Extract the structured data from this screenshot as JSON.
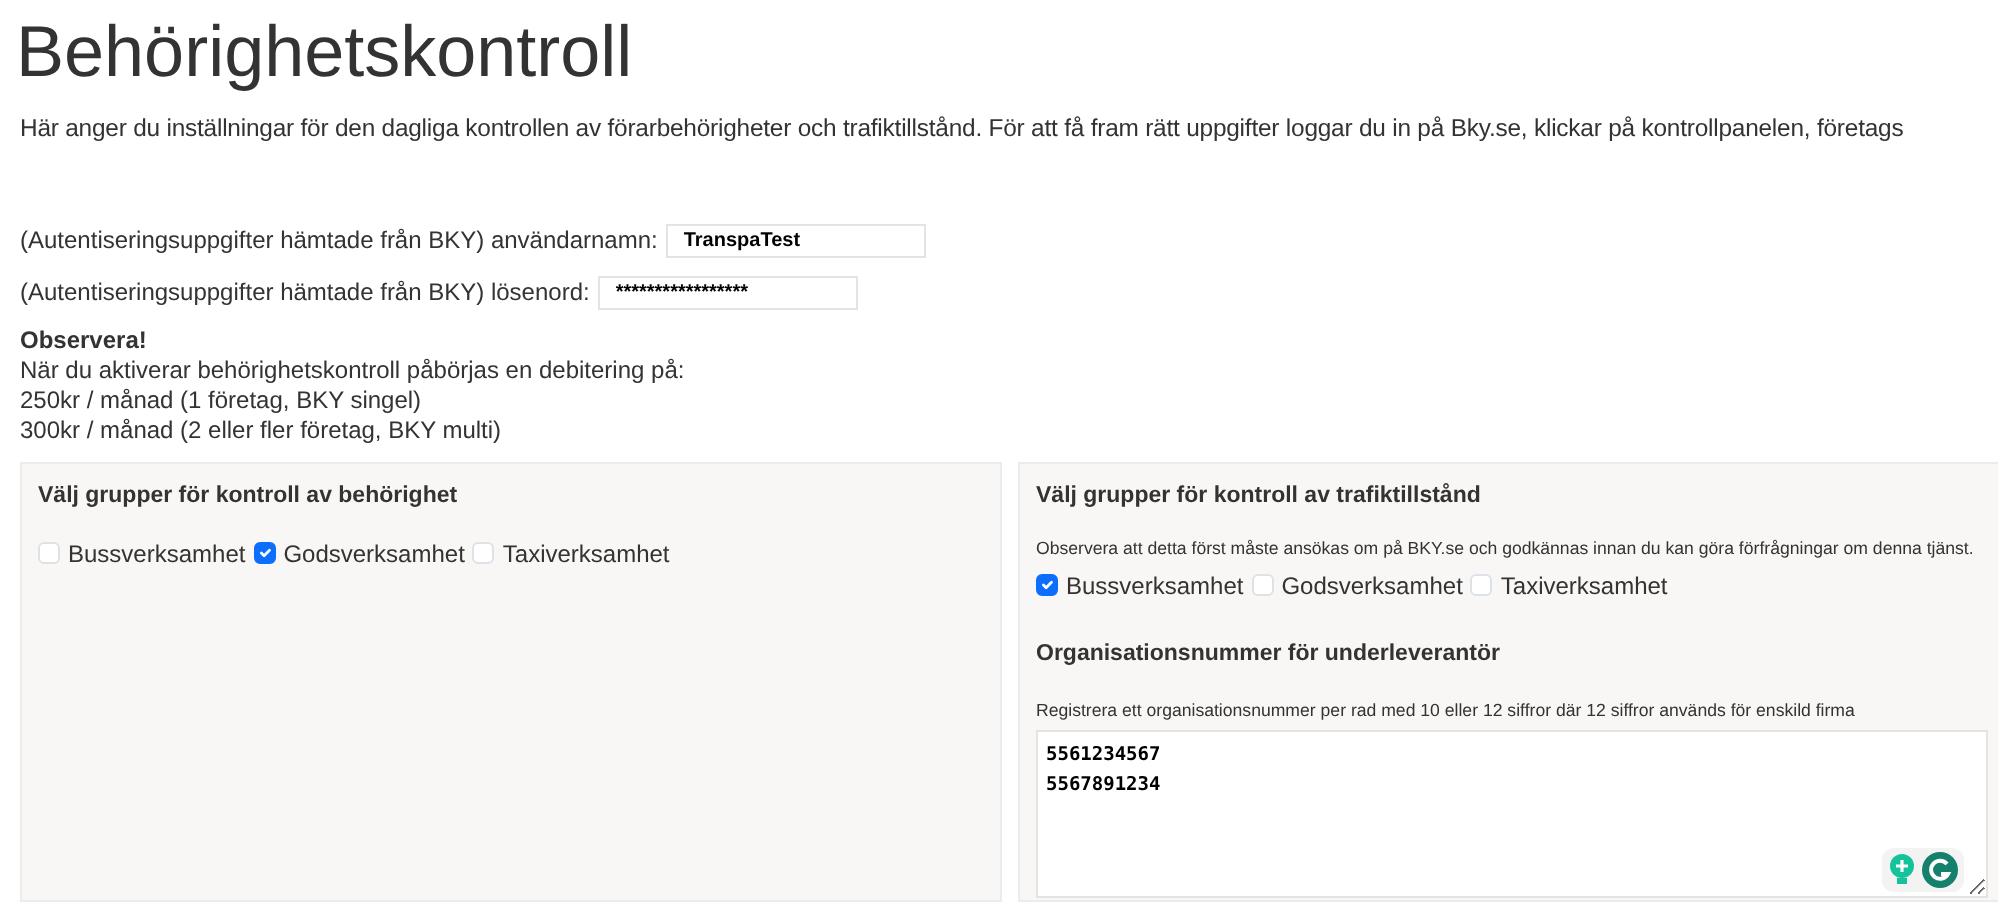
{
  "title": "Behörighetskontroll",
  "intro": "Här anger du inställningar för den dagliga kontrollen av förarbehörigheter och trafiktillstånd. För att få fram rätt uppgifter loggar du in på Bky.se, klickar på kontrollpanelen, företags",
  "credentials": [
    {
      "label": "(Autentiseringsuppgifter hämtade från BKY) användarnamn:",
      "value": "TranspaTest"
    },
    {
      "label": "(Autentiseringsuppgifter hämtade från BKY) lösenord:",
      "value": "*****************"
    }
  ],
  "notice": {
    "heading": "Observera!",
    "lines": [
      "När du aktiverar behörighetskontroll påbörjas en debitering på:",
      "250kr / månad (1 företag, BKY singel)",
      "300kr / månad (2 eller fler företag, BKY multi)"
    ]
  },
  "left_panel": {
    "heading": "Välj grupper för kontroll av behörighet",
    "options": [
      {
        "label": "Bussverksamhet",
        "checked": false
      },
      {
        "label": "Godsverksamhet",
        "checked": true
      },
      {
        "label": "Taxiverksamhet",
        "checked": false
      }
    ]
  },
  "right_panel": {
    "heading": "Välj grupper för kontroll av trafiktillstånd",
    "note": "Observera att detta först måste ansökas om på BKY.se och godkännas innan du kan göra förfrågningar om denna tjänst.",
    "options": [
      {
        "label": "Bussverksamhet",
        "checked": true
      },
      {
        "label": "Godsverksamhet",
        "checked": false
      },
      {
        "label": "Taxiverksamhet",
        "checked": false
      }
    ],
    "subheading": "Organisationsnummer för underleverantör",
    "hint": "Registrera ett organisationsnummer per rad med 10 eller 12 siffror där 12 siffror används för enskild firma",
    "numbers": [
      "5561234567",
      "5567891234"
    ]
  }
}
